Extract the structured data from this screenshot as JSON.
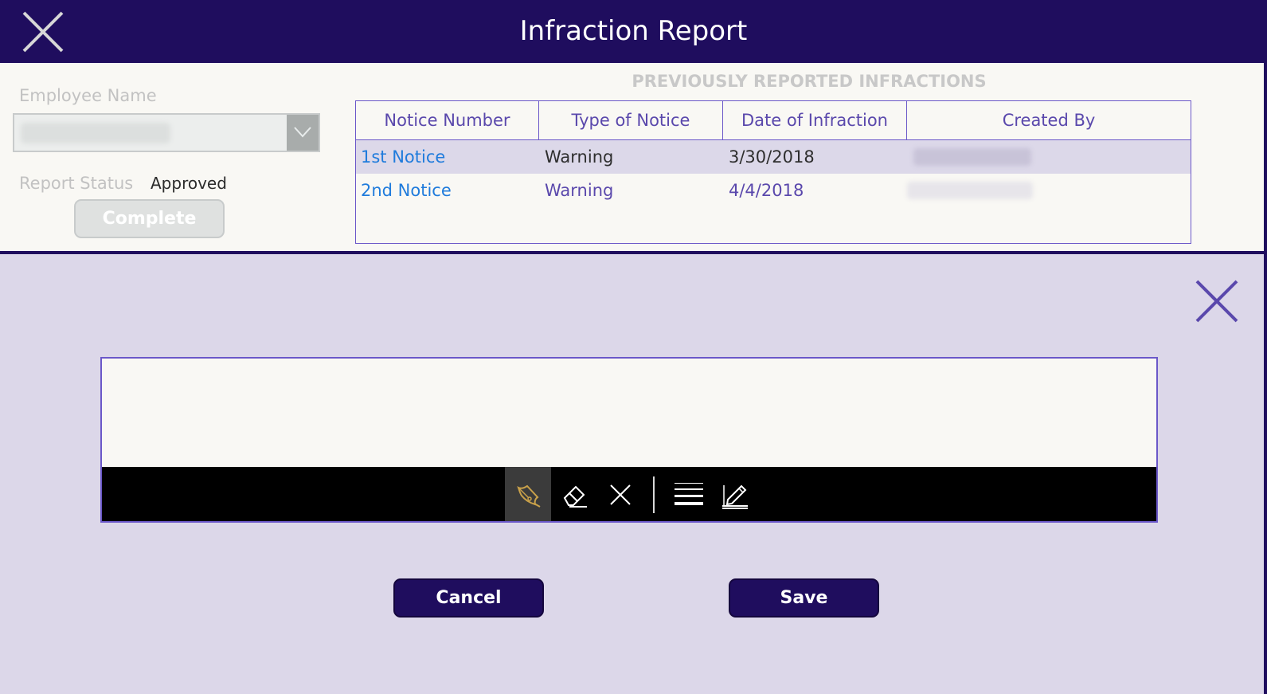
{
  "header": {
    "title": "Infraction Report",
    "close_icon": "close-icon"
  },
  "form": {
    "employee_name_label": "Employee Name",
    "employee_name_value": "",
    "dropdown_icon": "chevron-down-icon",
    "report_status_label": "Report Status",
    "report_status_value": "Approved",
    "complete_label": "Complete"
  },
  "infractions": {
    "title": "PREVIOUSLY REPORTED INFRACTIONS",
    "columns": [
      "Notice Number",
      "Type of Notice",
      "Date of Infraction",
      "Created By"
    ],
    "rows": [
      {
        "notice_number": "1st Notice",
        "type": "Warning",
        "date": "3/30/2018",
        "created_by": ""
      },
      {
        "notice_number": "2nd Notice",
        "type": "Warning",
        "date": "4/4/2018",
        "created_by": ""
      }
    ]
  },
  "signature": {
    "close_icon": "close-icon",
    "tools": [
      "pen-icon",
      "eraser-icon",
      "clear-icon",
      "stroke-width-icon",
      "edit-signature-icon"
    ],
    "active_tool": "pen-icon",
    "cancel_label": "Cancel",
    "save_label": "Save"
  },
  "colors": {
    "header": "#1f0d5e",
    "overlay": "#dcd7e9",
    "accent": "#6b58c9",
    "link": "#1f7bdc",
    "selected_row": "#dcd8e9",
    "active_pen": "#c9a14a"
  }
}
